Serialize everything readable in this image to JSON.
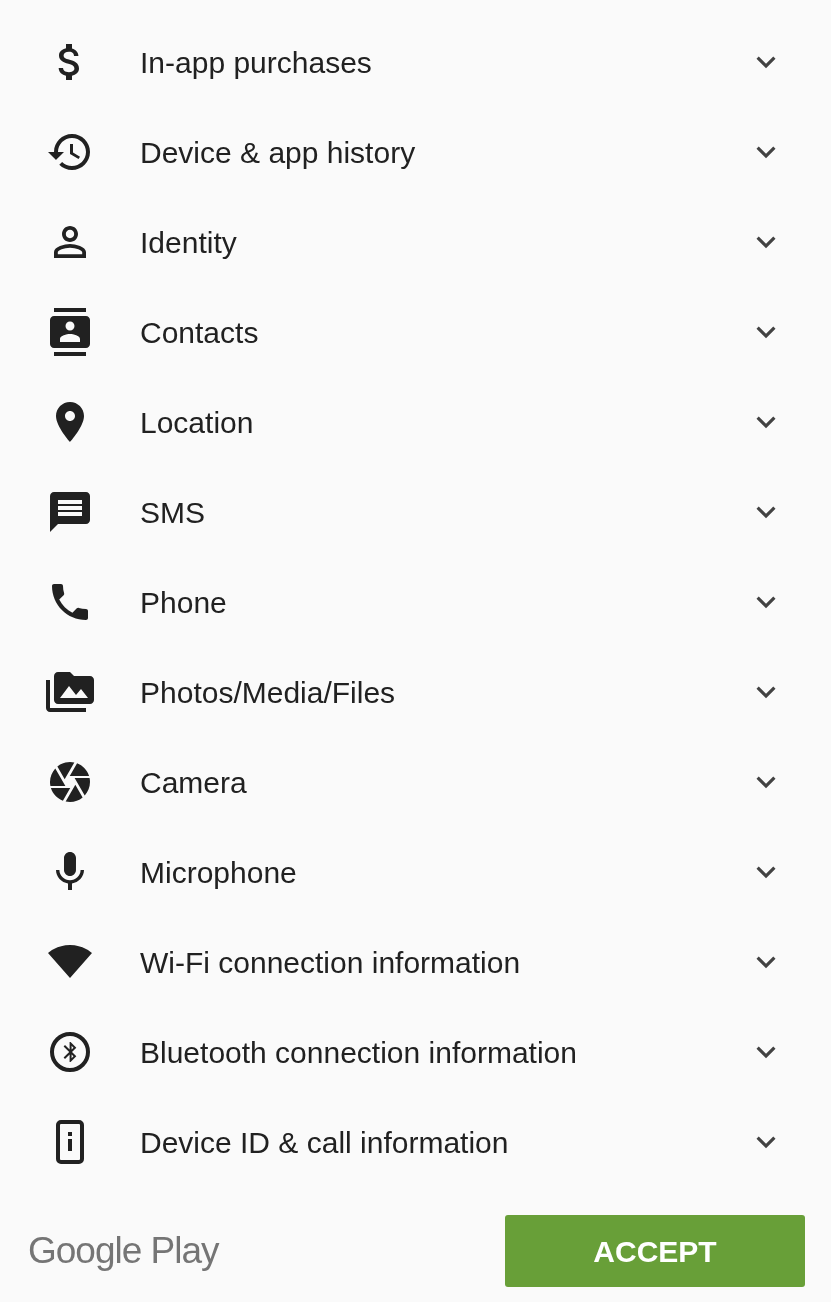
{
  "permissions": [
    {
      "label": "In-app purchases",
      "expanded": false
    },
    {
      "label": "Device & app history",
      "expanded": false
    },
    {
      "label": "Identity",
      "expanded": false
    },
    {
      "label": "Contacts",
      "expanded": false
    },
    {
      "label": "Location",
      "expanded": false
    },
    {
      "label": "SMS",
      "expanded": false
    },
    {
      "label": "Phone",
      "expanded": false
    },
    {
      "label": "Photos/Media/Files",
      "expanded": false
    },
    {
      "label": "Camera",
      "expanded": false
    },
    {
      "label": "Microphone",
      "expanded": false
    },
    {
      "label": "Wi-Fi connection information",
      "expanded": false
    },
    {
      "label": "Bluetooth connection information",
      "expanded": false
    },
    {
      "label": "Device ID & call information",
      "expanded": false
    }
  ],
  "footer": {
    "brand": "Google Play",
    "button": "ACCEPT"
  }
}
